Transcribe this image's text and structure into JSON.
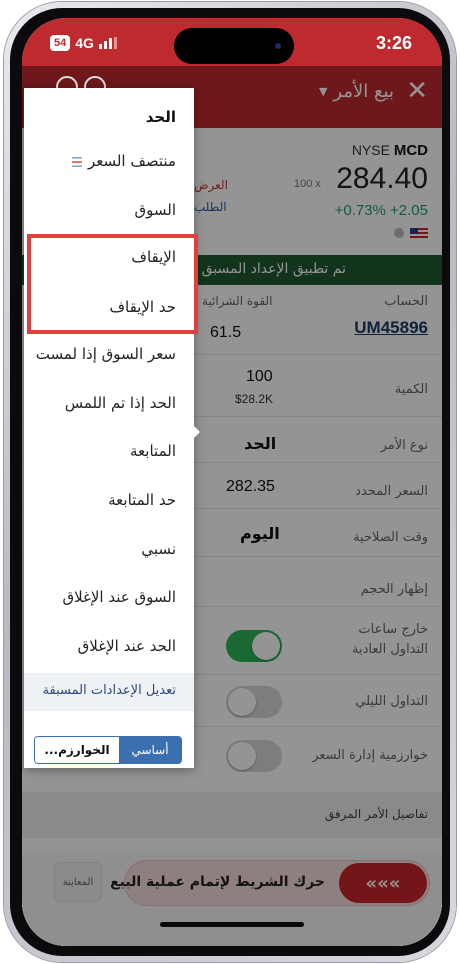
{
  "status_bar": {
    "badge": "54",
    "network": "4G",
    "time": "3:26"
  },
  "header": {
    "title": "بيع الأمر",
    "caret": "▼",
    "close": "✕"
  },
  "quote": {
    "exchange": "NYSE",
    "symbol": "MCD",
    "price": "284.40",
    "size": "100 x",
    "change": "+0.73%  +2.05",
    "bid_label": "العرض",
    "ask_label": "الطلب"
  },
  "banner": "تم تطبيق الإعداد المسبق",
  "form": {
    "account_label": "الحساب",
    "account_value": "UM45896",
    "buying_power_label": "القوة الشرائية",
    "buying_power_value": "61.5",
    "quantity_label": "الكمية",
    "quantity_value": "100",
    "quantity_sub": "$28.2K",
    "order_type_label": "نوع الأمر",
    "order_type_value": "الحد",
    "limit_price_label": "السعر المحدد",
    "limit_price_value": "282.35",
    "tif_label": "وقت الصلاحية",
    "tif_value": "اليوم",
    "display_size_label": "إظهار الحجم",
    "outside_rth_label_1": "خارج ساعات",
    "outside_rth_label_2": "التداول العادية",
    "overnight_label": "التداول الليلي",
    "algo_label": "خوارزمية إدارة السعر",
    "attached_label": "تفاصيل الأمر المرفق"
  },
  "toggles": {
    "outside_rth": true,
    "overnight": false,
    "algo": false
  },
  "bottom": {
    "preview": "المعاينة",
    "slider_text": "حرك الشريط لإتمام عملية البيع",
    "slider_icon": "«««"
  },
  "menu": {
    "items": [
      {
        "label": "الحد",
        "selected": true
      },
      {
        "label": "منتصف السعر",
        "icon": "midprice-icon"
      },
      {
        "label": "السوق"
      },
      {
        "label": "الإيقاف"
      },
      {
        "label": "حد الإيقاف"
      },
      {
        "label": "سعر السوق إذا لمست"
      },
      {
        "label": "الحد إذا تم اللمس"
      },
      {
        "label": "المتابعة"
      },
      {
        "label": "حد المتابعة"
      },
      {
        "label": "نسبي"
      },
      {
        "label": "السوق عند الإغلاق"
      },
      {
        "label": "الحد عند الإغلاق"
      }
    ],
    "edit_presets": "تعديل الإعدادات المسبقة",
    "segment_basic": "أساسي",
    "segment_algo": "الخوارزم..."
  },
  "colors": {
    "brand_red": "#bf2a2f",
    "positive_green": "#22a06b",
    "banner_green": "#1f5a32",
    "highlight": "#e0403a",
    "link_blue": "#3a6fb0"
  }
}
